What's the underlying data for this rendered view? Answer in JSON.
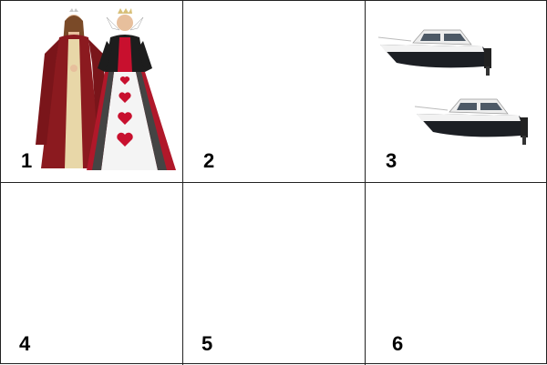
{
  "cells": [
    {
      "number": "1",
      "content": "two-women-in-gowns"
    },
    {
      "number": "2",
      "content": "empty"
    },
    {
      "number": "3",
      "content": "two-motor-boats"
    },
    {
      "number": "4",
      "content": "empty"
    },
    {
      "number": "5",
      "content": "empty"
    },
    {
      "number": "6",
      "content": "empty"
    }
  ],
  "colors": {
    "grid_line": "#222222",
    "gown_red": "#8b1a1f",
    "gown_cream": "#e8d7a8",
    "boat_hull": "#1c1f24",
    "boat_white": "#f2f2f2"
  }
}
